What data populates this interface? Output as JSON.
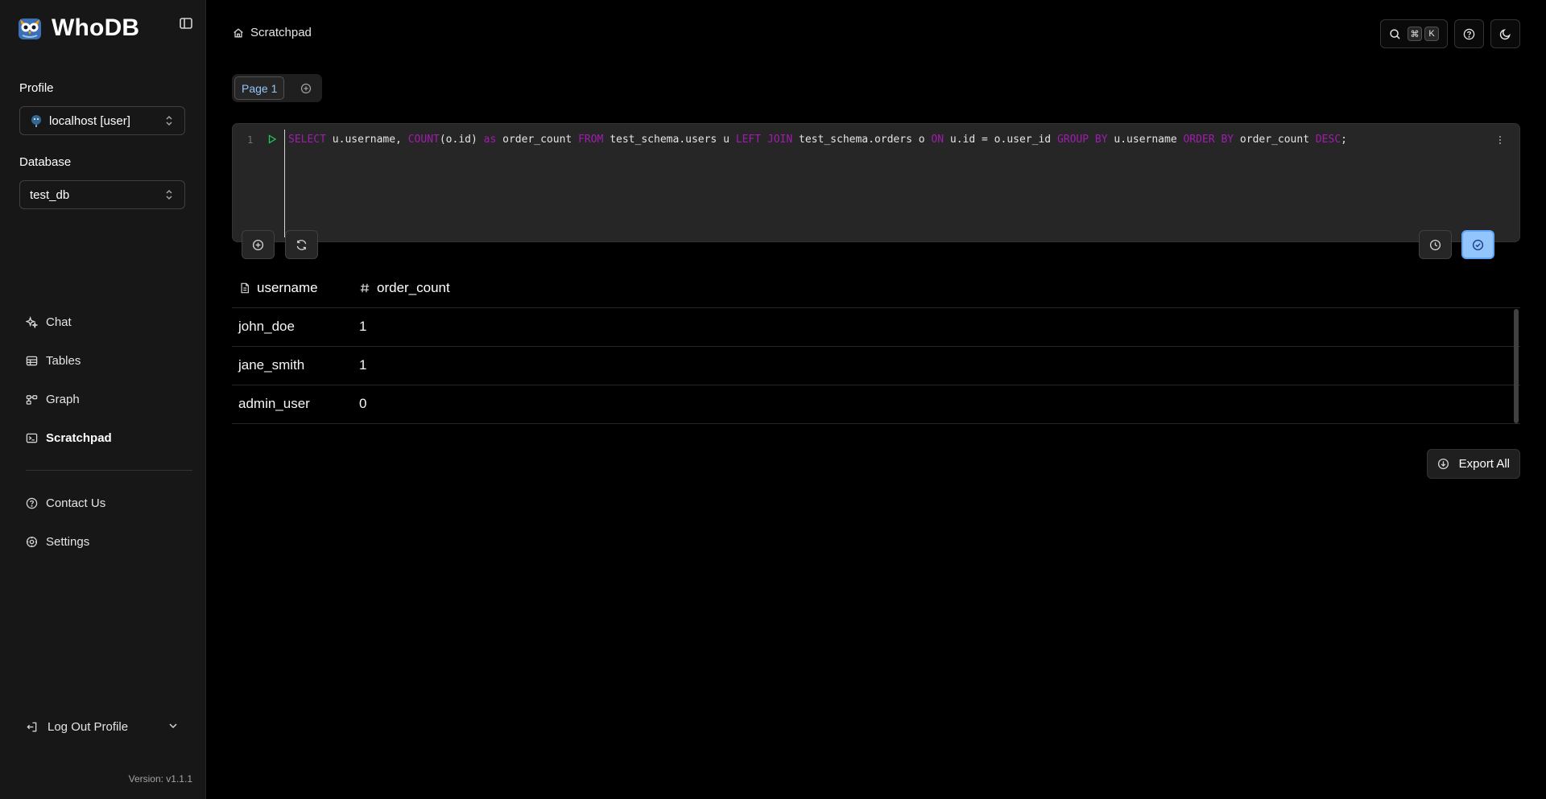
{
  "app": {
    "name": "WhoDB",
    "version": "Version: v1.1.1"
  },
  "sidebar": {
    "profile_label": "Profile",
    "profile_value": "localhost [user]",
    "database_label": "Database",
    "database_value": "test_db",
    "nav": [
      {
        "label": "Chat",
        "icon": "sparkles-icon"
      },
      {
        "label": "Tables",
        "icon": "table-icon"
      },
      {
        "label": "Graph",
        "icon": "graph-icon"
      },
      {
        "label": "Scratchpad",
        "icon": "terminal-icon",
        "active": true
      }
    ],
    "secondary": [
      {
        "label": "Contact Us",
        "icon": "help-circle-icon"
      },
      {
        "label": "Settings",
        "icon": "gear-icon"
      }
    ],
    "logout_label": "Log Out Profile"
  },
  "header": {
    "breadcrumb": "Scratchpad",
    "shortcut_keys": [
      "⌘",
      "K"
    ]
  },
  "tabs": [
    {
      "label": "Page 1",
      "active": true
    }
  ],
  "editor": {
    "line_number": "1",
    "tokens": [
      {
        "t": "SELECT",
        "kw": true
      },
      {
        "t": " u.username, "
      },
      {
        "t": "COUNT",
        "kw": true
      },
      {
        "t": "(o.id) "
      },
      {
        "t": "as",
        "kw": true
      },
      {
        "t": " order_count "
      },
      {
        "t": "FROM",
        "kw": true
      },
      {
        "t": " test_schema.users u "
      },
      {
        "t": "LEFT JOIN",
        "kw": true
      },
      {
        "t": " test_schema.orders o "
      },
      {
        "t": "ON",
        "kw": true
      },
      {
        "t": " u.id = o.user_id "
      },
      {
        "t": "GROUP BY",
        "kw": true
      },
      {
        "t": " u.username "
      },
      {
        "t": "ORDER BY",
        "kw": true
      },
      {
        "t": " order_count "
      },
      {
        "t": "DESC",
        "kw": true
      },
      {
        "t": ";"
      }
    ]
  },
  "results": {
    "columns": [
      {
        "name": "username",
        "type_icon": "text-file-icon"
      },
      {
        "name": "order_count",
        "type_icon": "hash-icon"
      }
    ],
    "rows": [
      [
        "john_doe",
        "1"
      ],
      [
        "jane_smith",
        "1"
      ],
      [
        "admin_user",
        "0"
      ]
    ]
  },
  "export_label": "Export All",
  "colors": {
    "accent": "#93c5fd",
    "keyword": "#a21caf",
    "run": "#22c55e"
  }
}
